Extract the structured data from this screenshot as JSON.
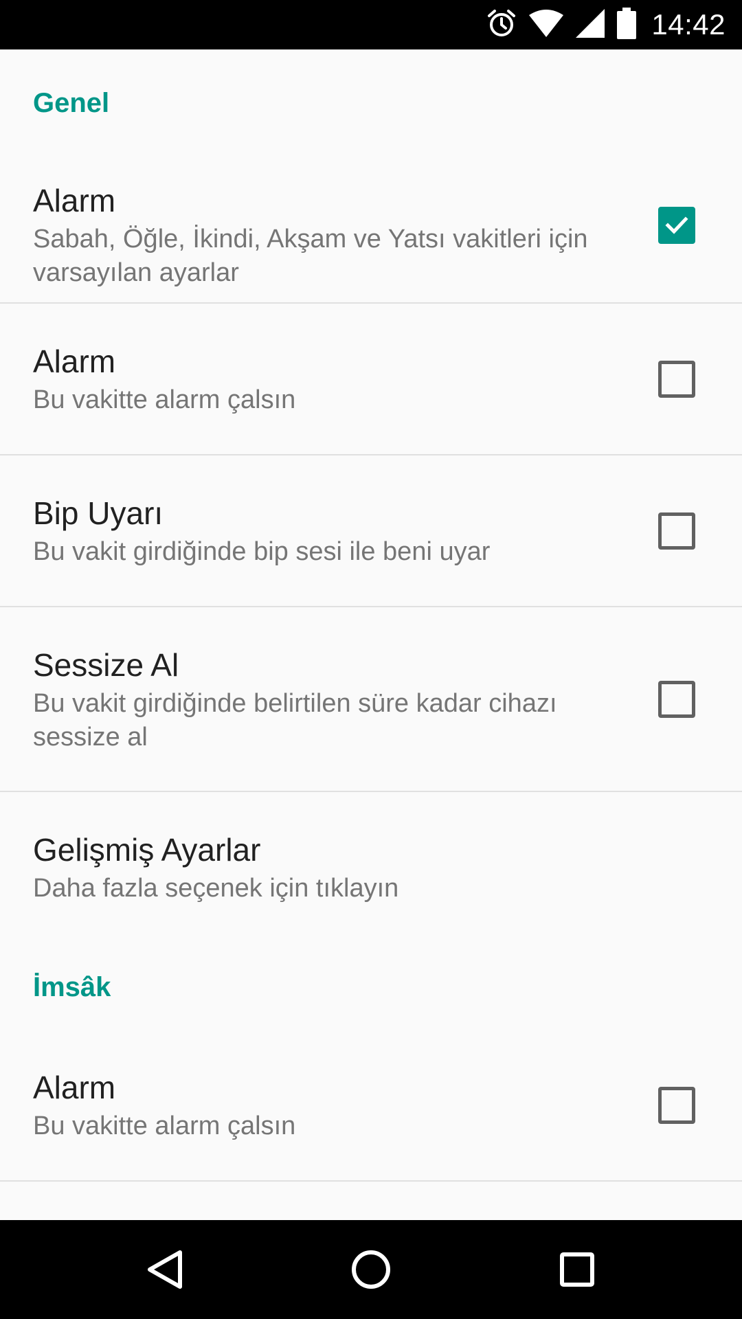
{
  "status_bar": {
    "time": "14:42",
    "icons": [
      "alarm-clock-icon",
      "wifi-icon",
      "cell-signal-icon",
      "battery-icon"
    ]
  },
  "colors": {
    "accent": "#009688",
    "title_text": "#212121",
    "summary_text": "#757575",
    "divider": "#e0e0e0",
    "background": "#fafafa"
  },
  "sections": [
    {
      "title": "Genel",
      "items": [
        {
          "title": "Alarm",
          "summary": "Sabah, Öğle, İkindi, Akşam ve Yatsı vakitleri için varsayılan ayarlar",
          "checked": true
        },
        {
          "title": "Alarm",
          "summary": "Bu vakitte alarm çalsın",
          "checked": false
        },
        {
          "title": "Bip Uyarı",
          "summary": "Bu vakit girdiğinde bip sesi ile beni uyar",
          "checked": false
        },
        {
          "title": "Sessize Al",
          "summary": "Bu vakit girdiğinde belirtilen süre kadar cihazı sessize al",
          "checked": false
        },
        {
          "title": "Gelişmiş Ayarlar",
          "summary": "Daha fazla seçenek için tıklayın"
        }
      ]
    },
    {
      "title": "İmsâk",
      "items": [
        {
          "title": "Alarm",
          "summary": "Bu vakitte alarm çalsın",
          "checked": false
        }
      ]
    }
  ],
  "nav_bar": {
    "buttons": [
      "back-icon",
      "home-icon",
      "recents-icon"
    ]
  }
}
